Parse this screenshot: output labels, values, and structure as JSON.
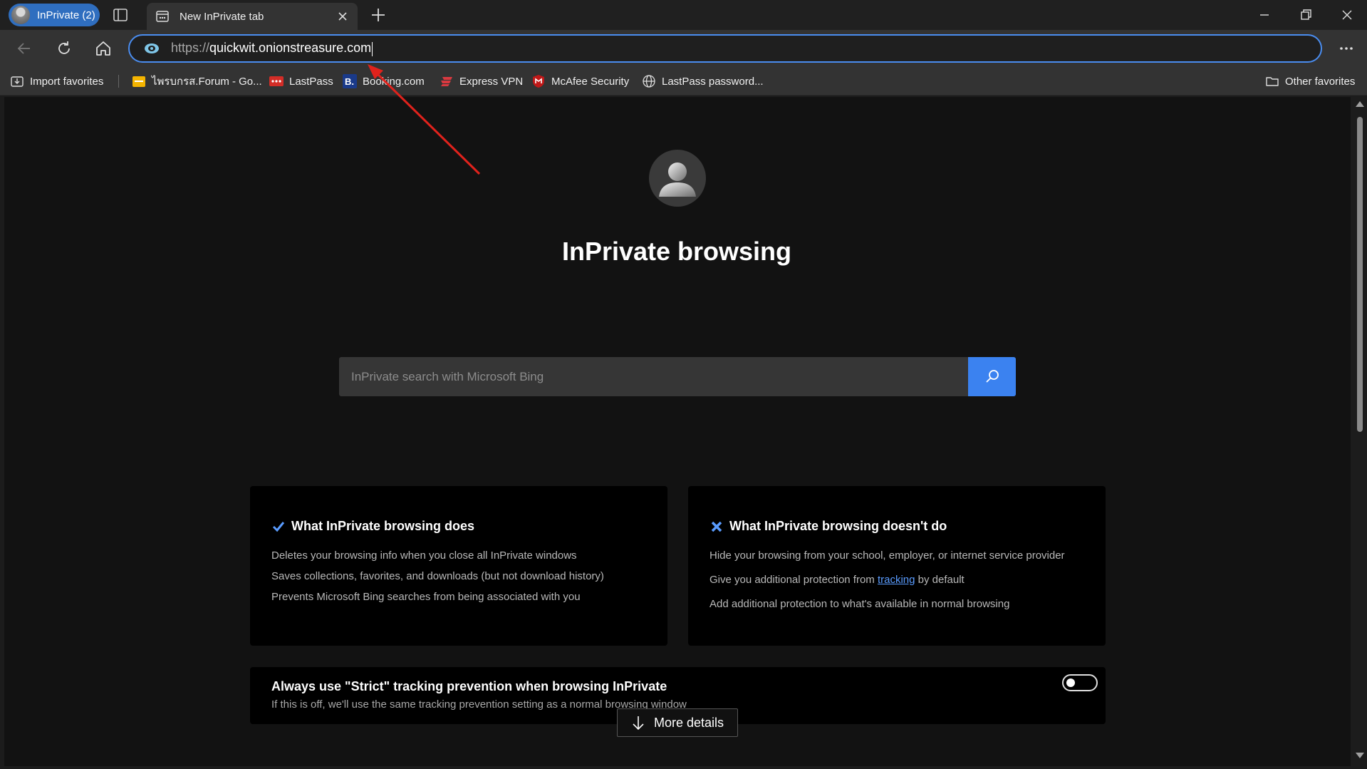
{
  "window": {
    "profile_label": "InPrivate (2)",
    "tab_title": "New InPrivate tab"
  },
  "address_bar": {
    "scheme": "https://",
    "host": "quickwit.onionstreasure.com"
  },
  "favorites": {
    "import": "Import favorites",
    "items": [
      {
        "label": "ไพรบกรส.Forum - Go...",
        "icon": "folder-yellow-icon"
      },
      {
        "label": "LastPass",
        "icon": "lastpass-icon"
      },
      {
        "label": "Booking.com",
        "icon": "booking-icon"
      },
      {
        "label": "Express VPN",
        "icon": "expressvpn-icon"
      },
      {
        "label": "McAfee Security",
        "icon": "mcafee-icon"
      },
      {
        "label": "LastPass password...",
        "icon": "globe-icon"
      }
    ],
    "other": "Other favorites"
  },
  "hero": {
    "title": "InPrivate browsing"
  },
  "search": {
    "placeholder": "InPrivate search with Microsoft Bing"
  },
  "does_card": {
    "heading": "What InPrivate browsing does",
    "lines": [
      "Deletes your browsing info when you close all InPrivate windows",
      "Saves collections, favorites, and downloads (but not download history)",
      "Prevents Microsoft Bing searches from being associated with you"
    ]
  },
  "doesnt_card": {
    "heading": "What InPrivate browsing doesn't do",
    "line1": "Hide your browsing from your school, employer, or internet service provider",
    "line2_pre": "Give you additional protection from ",
    "line2_link": "tracking",
    "line2_post": " by default",
    "line3": "Add additional protection to what's available in normal browsing"
  },
  "strict": {
    "title": "Always use \"Strict\" tracking prevention when browsing InPrivate",
    "subtitle": "If this is off, we'll use the same tracking prevention setting as a normal browsing window",
    "toggle_on": false
  },
  "more_details": "More details",
  "colors": {
    "accent": "#3b82f0",
    "address_border": "#4a8df0",
    "annotation_arrow": "#e0221c"
  }
}
